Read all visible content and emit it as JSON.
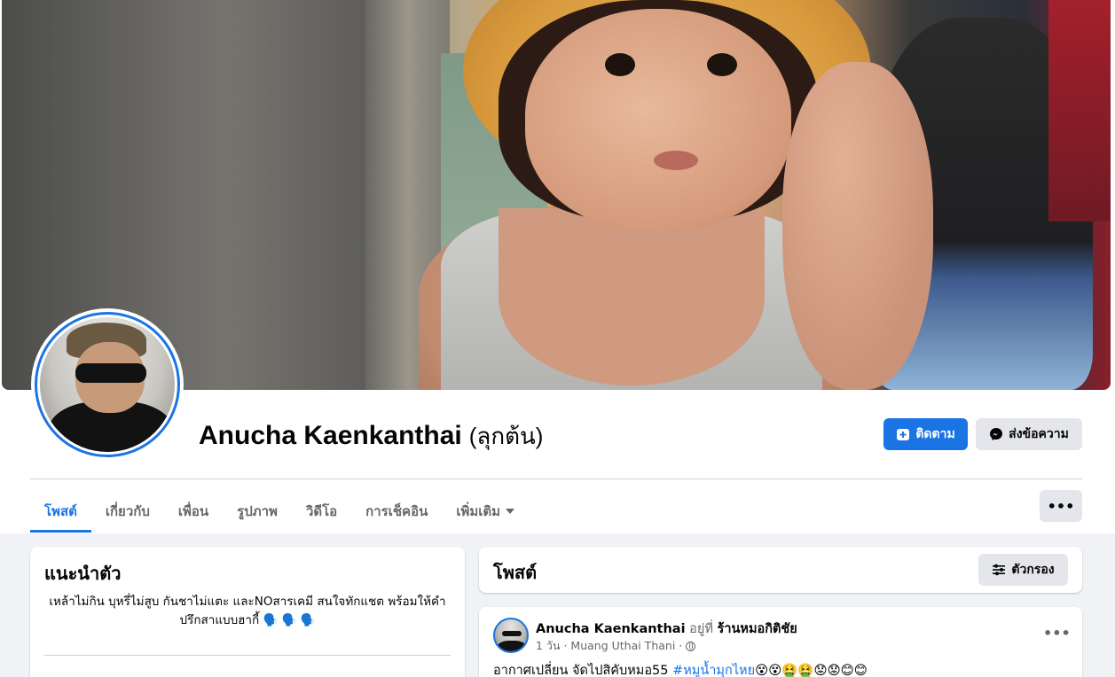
{
  "profile": {
    "name": "Anucha Kaenkanthai",
    "alternate_name": "(ลุกต้น)"
  },
  "actions": {
    "follow_label": "ติดตาม",
    "message_label": "ส่งข้อความ",
    "more_label": "•••"
  },
  "tabs": [
    {
      "label": "โพสต์",
      "active": true
    },
    {
      "label": "เกี่ยวกับ",
      "active": false
    },
    {
      "label": "เพื่อน",
      "active": false
    },
    {
      "label": "รูปภาพ",
      "active": false
    },
    {
      "label": "วิดีโอ",
      "active": false
    },
    {
      "label": "การเช็คอิน",
      "active": false
    },
    {
      "label": "เพิ่มเติม",
      "active": false
    }
  ],
  "intro": {
    "title": "แนะนำตัว",
    "bio": "เหล้าไม่กิน บุหรี่ไม่สูบ กันชาไม่แตะ และNOสารเคมี สนใจทักแชต พร้อมให้คำปรึกสาแบบฮากี้ 🗣️ 🗣️ 🗣️"
  },
  "posts_section": {
    "title": "โพสต์",
    "filter_label": "ตัวกรอง"
  },
  "post": {
    "author": "Anucha Kaenkanthai",
    "at_text": "อยู่ที่",
    "place": "ร้านหมอกิติชัย",
    "time_location": "1 วัน · Muang Uthai Thani ·",
    "text": "อากาศเปลี่ยน จัดไปสิคับหมอ55",
    "hashtag": "#หมูน้ำมุกไหย",
    "emojis": "😵😵🤮🤮😟😟😊😊",
    "more_label": "•••"
  },
  "colors": {
    "accent": "#1b74e4",
    "secondary_button": "#e4e6eb",
    "background": "#f0f2f5"
  }
}
